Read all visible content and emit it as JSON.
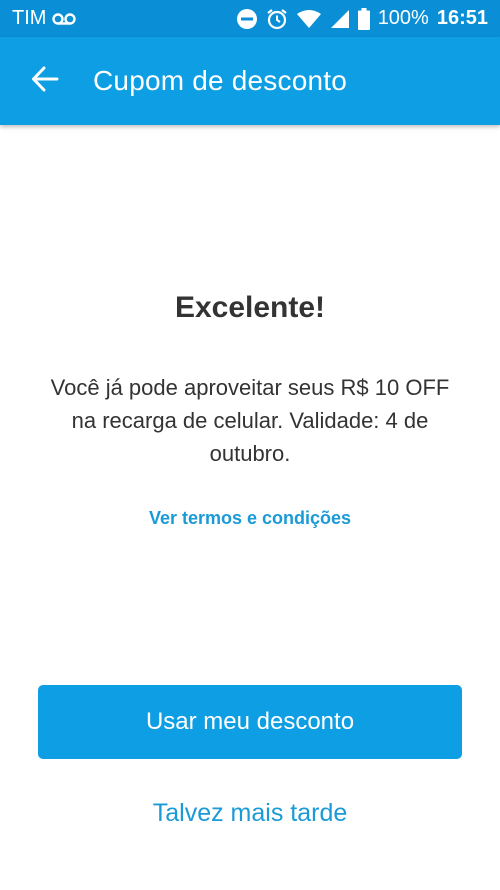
{
  "status_bar": {
    "carrier": "TIM",
    "battery": "100%",
    "time": "16:51",
    "icons": [
      "voicemail-icon",
      "dnd-icon",
      "alarm-icon",
      "wifi-icon",
      "signal-icon",
      "battery-icon"
    ]
  },
  "app_bar": {
    "title": "Cupom de desconto",
    "back_icon": "arrow-left-icon"
  },
  "main": {
    "headline": "Excelente!",
    "message": "Você já pode aproveitar seus R$ 10 OFF na recarga de celular. Validade: 4 de outubro.",
    "terms_link": "Ver termos e condições",
    "primary_button": "Usar meu desconto",
    "secondary_link": "Talvez mais tarde"
  },
  "colors": {
    "status_bar": "#0a8fd6",
    "app_bar": "#0d9ee3",
    "link": "#1a9ad6",
    "text": "#333333",
    "background": "#ffffff"
  }
}
